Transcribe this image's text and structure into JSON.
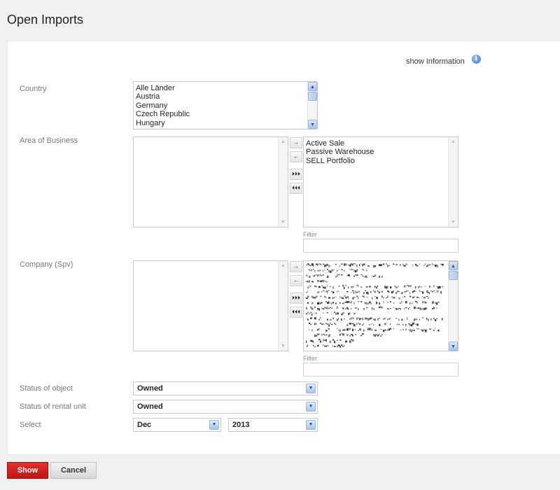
{
  "page": {
    "title": "Open Imports",
    "show_information": "show Information"
  },
  "icons": {
    "info": "info-icon",
    "arrow_right": "→",
    "arrow_left": "←",
    "double_right": "⏵⏵⏵",
    "double_left": "⏴⏴⏴",
    "scroll_up": "▲",
    "scroll_down": "▼",
    "dropdown": "▼"
  },
  "country": {
    "label": "Country",
    "options": [
      "Alle Länder",
      "Austria",
      "Germany",
      "Czech Republic",
      "Hungary"
    ]
  },
  "area_of_business": {
    "label": "Area of Business",
    "available": [],
    "selected": [
      "Active Sale",
      "Passive Warehouse",
      "SELL Portfolio"
    ],
    "filter_label": "Filter",
    "filter_value": ""
  },
  "company": {
    "label": "Company (Spv)",
    "available": [],
    "filter_label": "Filter",
    "filter_value": ""
  },
  "status_of_object": {
    "label": "Status of object",
    "value": "Owned"
  },
  "status_of_rental_unit": {
    "label": "Status of rental unit",
    "value": "Owned"
  },
  "select_period": {
    "label": "Select",
    "month": "Dec",
    "year": "2013"
  },
  "buttons": {
    "show": "Show",
    "cancel": "Cancel"
  },
  "colors": {
    "primary_button": "#d42422",
    "scroll_accent": "#aac6ec"
  }
}
